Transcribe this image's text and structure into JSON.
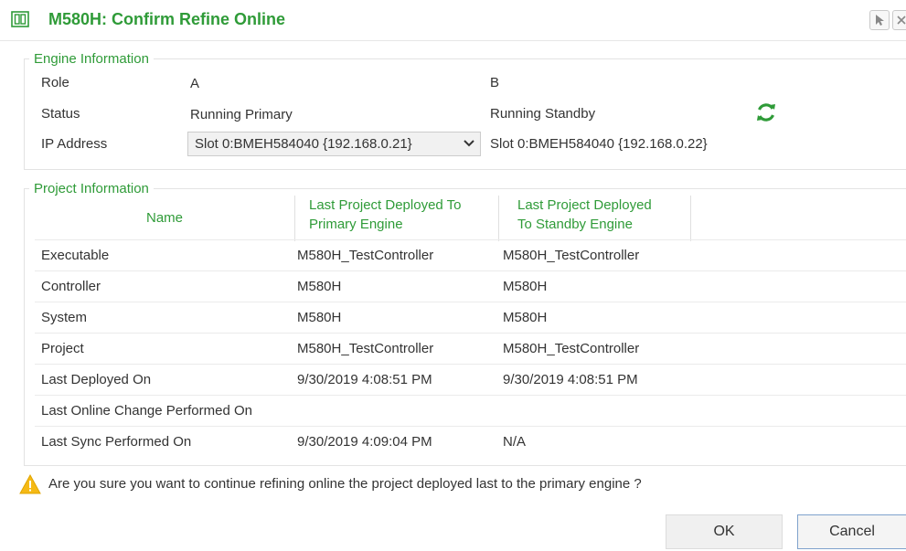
{
  "title": "M580H: Confirm Refine Online",
  "colors": {
    "accent": "#2f9b38",
    "warning": "#f5b915"
  },
  "icons": {
    "title": "hsby-dialog-icon",
    "pointer": "pointer-icon",
    "close": "close-icon",
    "refresh": "refresh-icon",
    "warning": "warning-icon",
    "dropdown": "chevron-down-icon"
  },
  "engine_info": {
    "legend": "Engine Information",
    "role": {
      "label": "Role",
      "a": "A",
      "b": "B"
    },
    "status": {
      "label": "Status",
      "a": "Running Primary",
      "b": "Running Standby"
    },
    "ip": {
      "label": "IP Address",
      "a": "Slot 0:BMEH584040 {192.168.0.21}",
      "b": "Slot 0:BMEH584040 {192.168.0.22}"
    }
  },
  "project_info": {
    "legend": "Project Information",
    "headers": {
      "name": "Name",
      "primary_line1": "Last Project Deployed To",
      "primary_line2": "Primary Engine",
      "standby_line1": "Last Project Deployed",
      "standby_line2": "To Standby Engine"
    },
    "rows": [
      {
        "name": "Executable",
        "primary": "M580H_TestController",
        "standby": "M580H_TestController"
      },
      {
        "name": "Controller",
        "primary": "M580H",
        "standby": "M580H"
      },
      {
        "name": "System",
        "primary": "M580H",
        "standby": "M580H"
      },
      {
        "name": "Project",
        "primary": "M580H_TestController",
        "standby": "M580H_TestController"
      },
      {
        "name": "Last Deployed On",
        "primary": "9/30/2019 4:08:51 PM",
        "standby": "9/30/2019 4:08:51 PM"
      },
      {
        "name": "Last Online Change Performed On",
        "primary": "",
        "standby": ""
      },
      {
        "name": "Last Sync Performed On",
        "primary": "9/30/2019 4:09:04 PM",
        "standby": "N/A"
      }
    ]
  },
  "warning": "Are you sure you want to continue refining online the project deployed last to the primary engine ?",
  "buttons": {
    "ok": "OK",
    "cancel": "Cancel"
  }
}
